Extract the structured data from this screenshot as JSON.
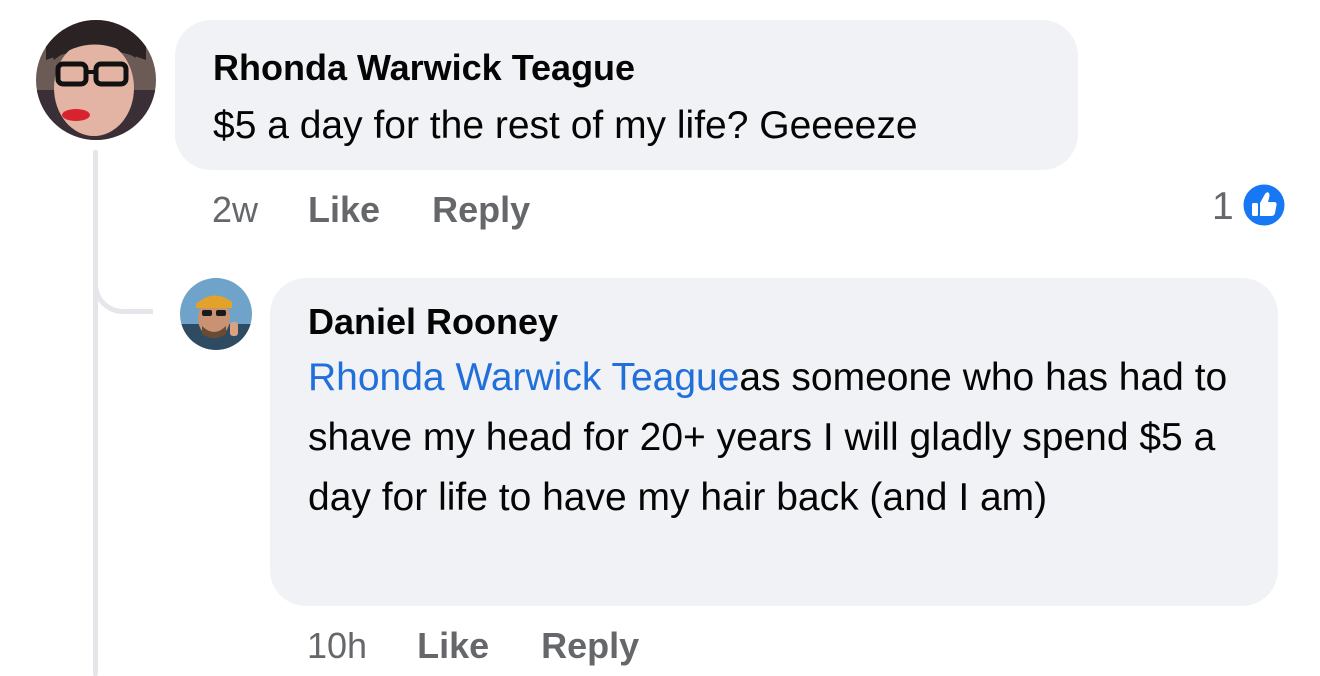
{
  "comments": [
    {
      "author": "Rhonda Warwick Teague",
      "text": "$5 a day for the rest of my life? Geeeeze",
      "time": "2w",
      "like_label": "Like",
      "reply_label": "Reply",
      "reaction_count": "1",
      "reaction_icon": "like-icon"
    },
    {
      "author": "Daniel Rooney",
      "mention": "Rhonda Warwick Teague",
      "text": "as someone who has had to shave my head for 20+ years I will gladly spend $5 a day for life to have my hair back (and I am)",
      "time": "10h",
      "like_label": "Like",
      "reply_label": "Reply"
    }
  ],
  "colors": {
    "bubble_bg": "#f0f2f5",
    "mention": "#216fdb",
    "like_blue": "#1877f2",
    "meta_gray": "#65676b"
  }
}
